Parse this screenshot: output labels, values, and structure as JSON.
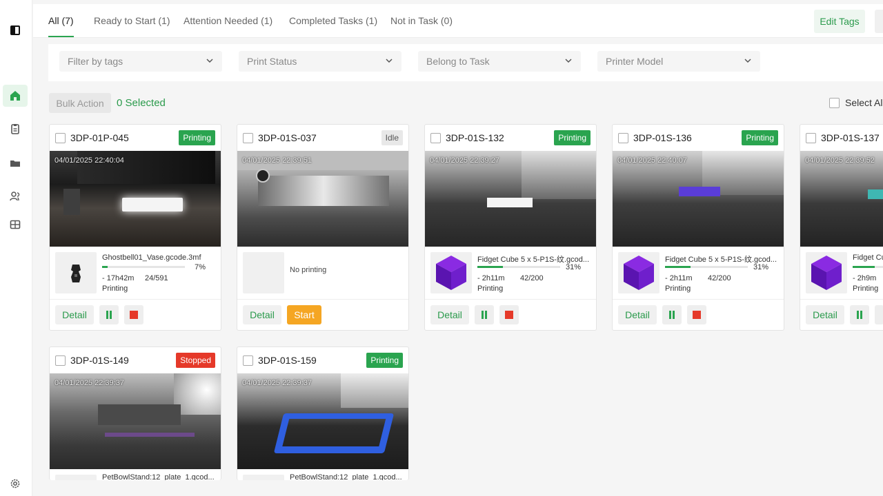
{
  "tabs": [
    {
      "label": "All (7)"
    },
    {
      "label": "Ready to Start (1)"
    },
    {
      "label": "Attention Needed (1)"
    },
    {
      "label": "Completed Tasks (1)"
    },
    {
      "label": "Not in Task (0)"
    }
  ],
  "edit_tags_label": "Edit Tags",
  "filters": [
    {
      "placeholder": "Filter by tags"
    },
    {
      "placeholder": "Print Status"
    },
    {
      "placeholder": "Belong to Task"
    },
    {
      "placeholder": "Printer Model"
    }
  ],
  "bulk_action_label": "Bulk Action",
  "selected_label": "0 Selected",
  "select_all_label": "Select All",
  "buttons": {
    "detail": "Detail",
    "start": "Start"
  },
  "printers": [
    {
      "name": "3DP-01P-045",
      "status": "Printing",
      "timestamp": "04/01/2025 22:40:04",
      "file": "Ghostbell01_Vase.gcode.3mf",
      "progress_pct": "7%",
      "progress_fraction": 0.07,
      "eta": "- 17h42m",
      "layers": "24/591",
      "state": "Printing"
    },
    {
      "name": "3DP-01S-037",
      "status": "Idle",
      "timestamp": "04/01/2025 22:39:51",
      "no_printing": "No printing"
    },
    {
      "name": "3DP-01S-132",
      "status": "Printing",
      "timestamp": "04/01/2025 22:39:27",
      "file": "Fidget Cube 5 x 5-P1S-纹.gcod...",
      "progress_pct": "31%",
      "progress_fraction": 0.31,
      "eta": "- 2h11m",
      "layers": "42/200",
      "state": "Printing"
    },
    {
      "name": "3DP-01S-136",
      "status": "Printing",
      "timestamp": "04/01/2025 22:40:07",
      "file": "Fidget Cube 5 x 5-P1S-纹.gcod...",
      "progress_pct": "31%",
      "progress_fraction": 0.31,
      "eta": "- 2h11m",
      "layers": "42/200",
      "state": "Printing"
    },
    {
      "name": "3DP-01S-137",
      "status": "Printing",
      "timestamp": "04/01/2025 22:39:52",
      "file": "Fidget Cu",
      "progress_pct": "",
      "progress_fraction": 0.3,
      "eta": "- 2h9m",
      "layers": "",
      "state": "Printing"
    },
    {
      "name": "3DP-01S-149",
      "status": "Stopped",
      "timestamp": "04/01/2025 22:39:37",
      "file": "PetBowlStand:12_plate_1.gcod..."
    },
    {
      "name": "3DP-01S-159",
      "status": "Printing",
      "timestamp": "04/01/2025 22:39:37",
      "file": "PetBowlStand:12_plate_1.gcod..."
    }
  ],
  "colors": {
    "accent": "#2aa44f",
    "start": "#f5a623",
    "stop": "#e53929"
  }
}
